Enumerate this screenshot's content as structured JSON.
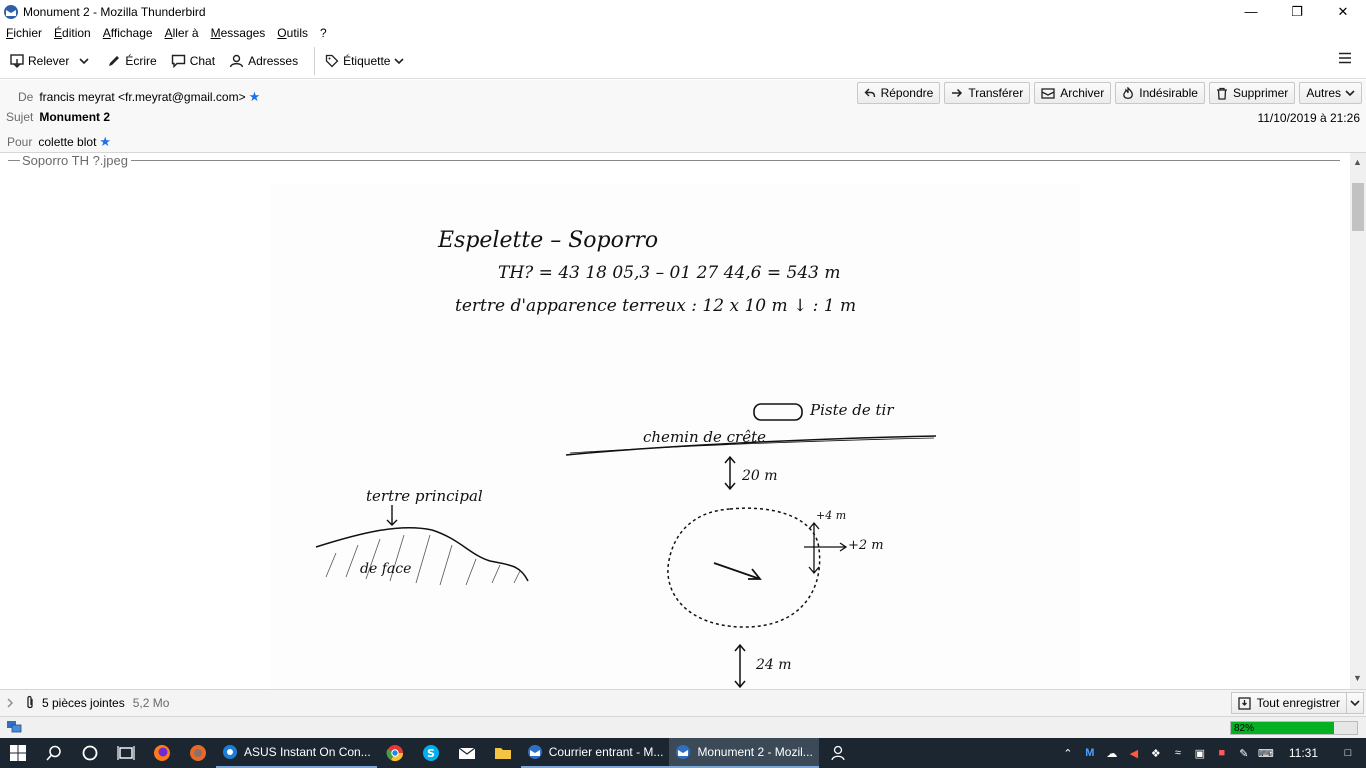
{
  "window": {
    "title": "Monument 2 - Mozilla Thunderbird"
  },
  "menubar": {
    "items": [
      "Fichier",
      "Édition",
      "Affichage",
      "Aller à",
      "Messages",
      "Outils",
      "?"
    ]
  },
  "toolbar": {
    "get_mail": "Relever",
    "write": "Écrire",
    "chat": "Chat",
    "address_book": "Adresses",
    "tag": "Étiquette"
  },
  "header": {
    "from_label": "De",
    "from_value": "francis meyrat <fr.meyrat@gmail.com>",
    "subject_label": "Sujet",
    "subject_value": "Monument 2",
    "to_label": "Pour",
    "to_value": "colette blot",
    "date": "11/10/2019 à 21:26",
    "actions": {
      "reply": "Répondre",
      "forward": "Transférer",
      "archive": "Archiver",
      "junk": "Indésirable",
      "delete": "Supprimer",
      "more": "Autres"
    }
  },
  "body": {
    "attachment_name": "Soporro TH ?.jpeg",
    "sketch": {
      "line1": "Espelette – Soporro",
      "line2": "TH? = 43 18 05,3 – 01 27 44,6 = 543 m",
      "line3": "tertre d'apparence terreux : 12 x 10 m ↓ : 1 m",
      "piste": "Piste de tir",
      "chemin": "chemin de crête",
      "dist1": "20 m",
      "tertre_principal": "tertre principal",
      "de_face": "de face",
      "d1": "+4 m",
      "d2": "+2 m",
      "dist2": "24 m"
    }
  },
  "attachments": {
    "count_label": "5 pièces jointes",
    "size": "5,2 Mo",
    "save_all": "Tout enregistrer"
  },
  "status": {
    "progress_label": "82%",
    "progress_value": 0.82
  },
  "taskbar": {
    "apps": [
      "ASUS Instant On Con...",
      "Courrier entrant - M...",
      "Monument 2 - Mozil..."
    ],
    "clock": "11:31"
  }
}
